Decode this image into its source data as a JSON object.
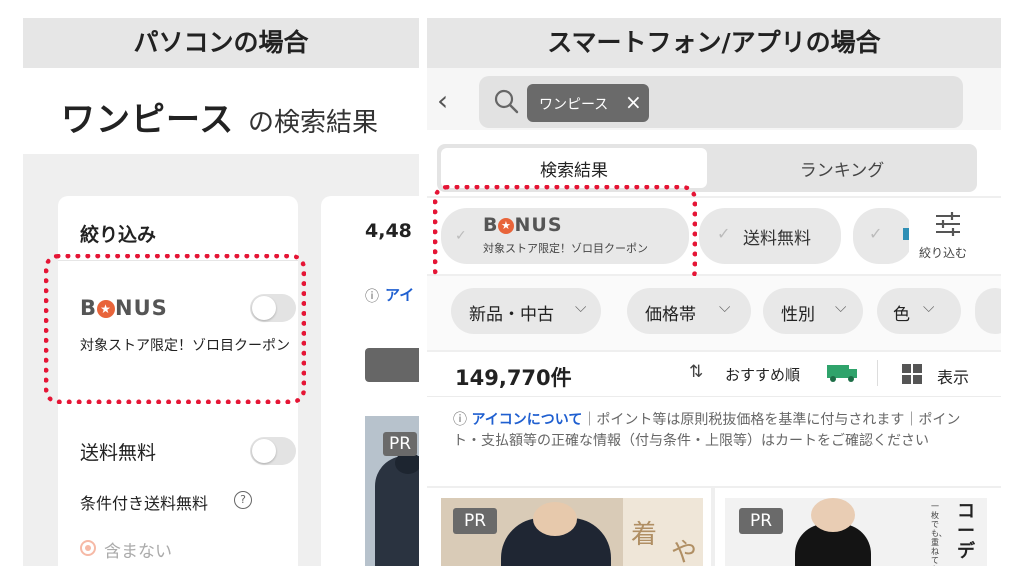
{
  "pc": {
    "heading": "パソコンの場合",
    "title": "ワンピース",
    "title_suffix": "の検索結果",
    "filter_title": "絞り込み",
    "bonus_logo_pre": "B",
    "bonus_logo_post": "NUS",
    "bonus_desc": "対象ストア限定！ゾロ目クーポン",
    "free_shipping": "送料無料",
    "conditional_free_shipping": "条件付き送料無料",
    "help_icon": "?",
    "radio_label": "含まない",
    "result_count_partial": "4,48",
    "info_partial": "アイ",
    "pr": "PR"
  },
  "sp": {
    "heading": "スマートフォン/アプリの場合",
    "search_chip": "ワンピース",
    "chip_close": "×",
    "tab_results": "検索結果",
    "tab_ranking": "ランキング",
    "bonus_logo_pre": "B",
    "bonus_logo_post": "NUS",
    "bonus_desc": "対象ストア限定！ゾロ目クーポン",
    "free_shipping": "送料無料",
    "filter_label": "絞り込む",
    "filters": [
      "新品・中古",
      "価格帯",
      "性別",
      "色"
    ],
    "result_count": "149,770件",
    "sort_label": "おすすめ順",
    "display_label": "表示",
    "notice_link": "アイコンについて",
    "notice_text": "｜ポイント等は原則税抜価格を基準に付与されます｜ポイント・支払額等の正確な情報（付与条件・上限等）はカートをご確認ください",
    "pr": "PR",
    "img1_text_a": "着",
    "img1_text_b": "や",
    "img2_text": "コーデ",
    "img2_small": "一枚でも、重ねても。"
  },
  "colors": {
    "dots": "#e51535",
    "bonus_o": "#e8643a",
    "link": "#1f5fd0",
    "truck": "#2fa36b"
  }
}
